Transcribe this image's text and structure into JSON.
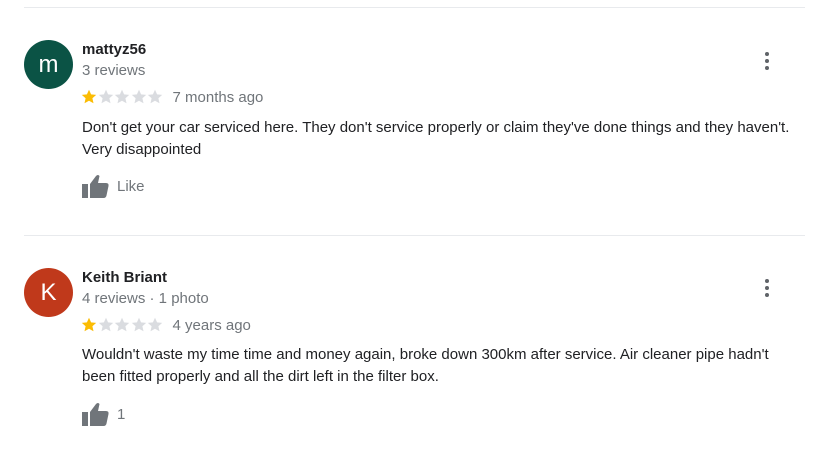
{
  "colors": {
    "star_filled": "#fbbc04",
    "star_empty": "#dadce0",
    "icon_gray": "#70757a"
  },
  "reviews": [
    {
      "avatar_letter": "m",
      "avatar_color": "#0b5345",
      "name": "mattyz56",
      "meta": "3 reviews",
      "rating": 1,
      "max_rating": 5,
      "time_ago": "7 months ago",
      "text": "Don't get your car serviced here. They don't service properly or claim they've done things and they haven't. Very disappointed",
      "like_label": "Like",
      "more_icon": "more-vert-icon",
      "like_icon": "thumb-up-icon"
    },
    {
      "avatar_letter": "K",
      "avatar_color": "#c0391b",
      "name": "Keith Briant",
      "meta": "4 reviews · 1 photo",
      "rating": 1,
      "max_rating": 5,
      "time_ago": "4 years ago",
      "text": "Wouldn't waste my time time and money again, broke down  300km after service. Air cleaner pipe hadn't been fitted properly and all the dirt left in the filter box.",
      "like_label": "1",
      "more_icon": "more-vert-icon",
      "like_icon": "thumb-up-icon"
    }
  ]
}
